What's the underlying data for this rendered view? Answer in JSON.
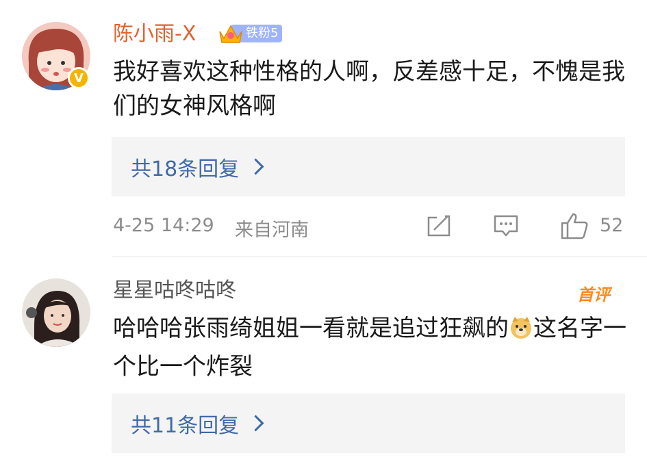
{
  "comments": [
    {
      "username": "陈小雨-X",
      "badge_label": "铁粉5",
      "text": "我好喜欢这种性格的人啊，反差感十足，不愧是我们的女神风格啊",
      "replies": "共18条回复",
      "time": "4-25 14:29",
      "location": "来自河南",
      "likes": "52"
    },
    {
      "username": "星星咕咚咕咚",
      "tag": "首评",
      "text_before_emoji": "哈哈哈张雨绮姐姐一看就是追过狂飙的",
      "emoji": "doge-emoji",
      "text_after_emoji": "这名字一个比一个炸裂",
      "replies": "共11条回复"
    }
  ],
  "colors": {
    "username_first": "#e2622f",
    "username_second": "#555555",
    "reply_link": "#3f6aa8",
    "meta": "#8c8c8c",
    "first_tag": "#ff8a1f",
    "badge": "#9fb3ff",
    "verified": "#f5b400"
  }
}
